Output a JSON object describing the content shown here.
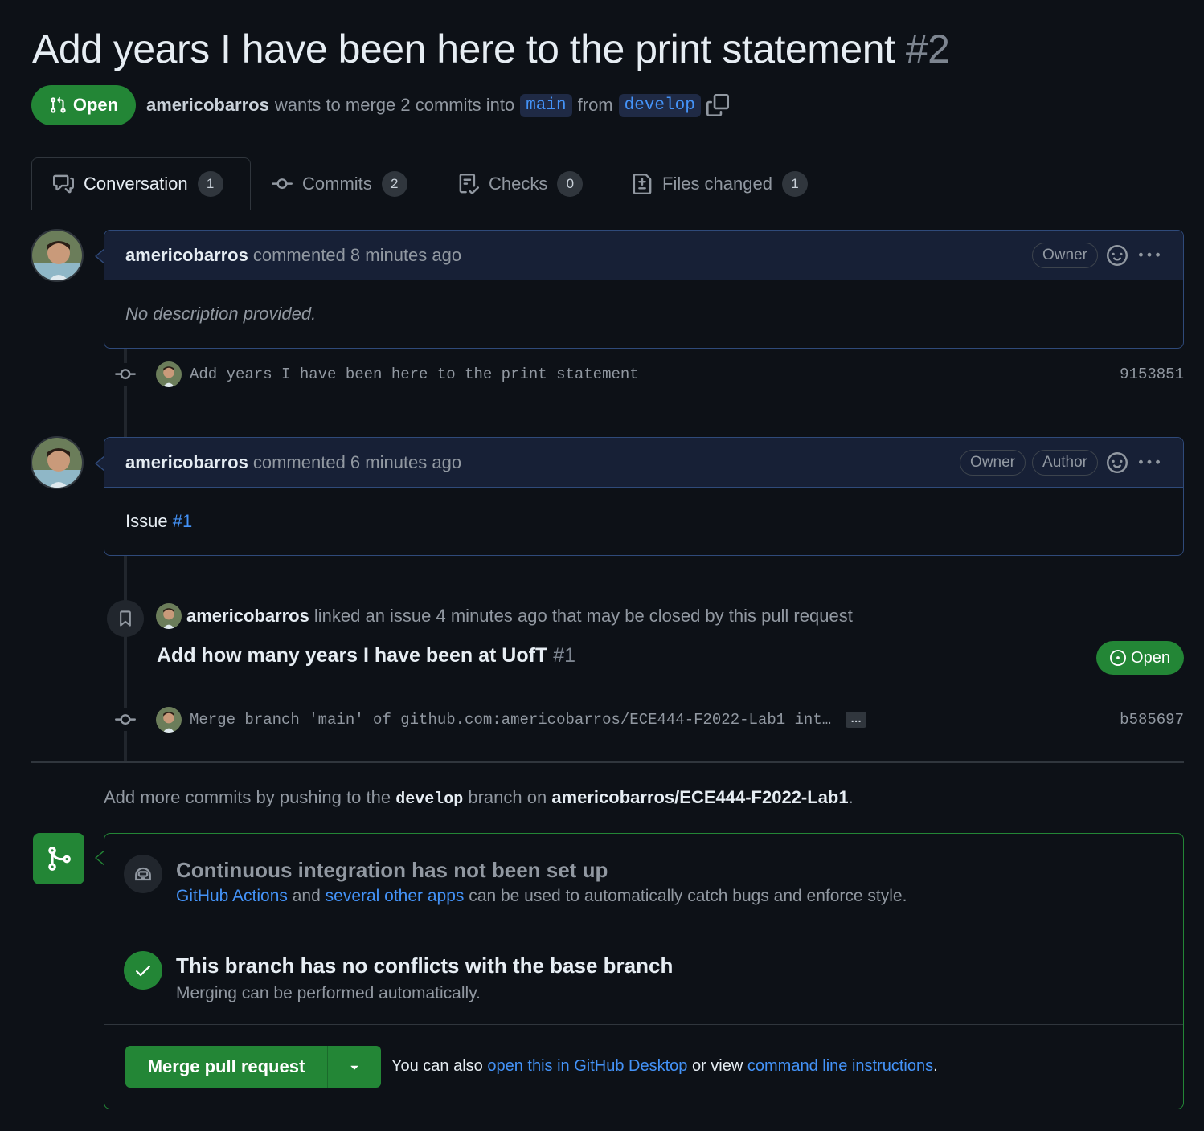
{
  "pr": {
    "title": "Add years I have been here to the print statement",
    "number": "#2",
    "state": "Open",
    "author": "americobarros",
    "meta_wants": "wants to merge 2 commits into",
    "base_branch": "main",
    "meta_from": "from",
    "head_branch": "develop"
  },
  "tabs": [
    {
      "label": "Conversation",
      "count": "1",
      "icon": "comment-discussion-icon"
    },
    {
      "label": "Commits",
      "count": "2",
      "icon": "commit-icon"
    },
    {
      "label": "Checks",
      "count": "0",
      "icon": "checklist-icon"
    },
    {
      "label": "Files changed",
      "count": "1",
      "icon": "file-diff-icon"
    }
  ],
  "comments": [
    {
      "author": "americobarros",
      "action": "commented 8 minutes ago",
      "roles": [
        "Owner"
      ],
      "body": "No description provided."
    },
    {
      "author": "americobarros",
      "action": "commented 6 minutes ago",
      "roles": [
        "Owner",
        "Author"
      ],
      "body_prefix": "Issue",
      "body_link": "#1"
    }
  ],
  "commits": [
    {
      "message": "Add years I have been here to the print statement",
      "sha": "9153851"
    },
    {
      "message": "Merge branch 'main' of github.com:americobarros/ECE444-F2022-Lab1 int…",
      "sha": "b585697",
      "more": "…"
    }
  ],
  "linked_event": {
    "author": "americobarros",
    "text_before": "linked an issue 4 minutes ago that may be",
    "text_closed": "closed",
    "text_after": "by this pull request",
    "issue_title": "Add how many years I have been at UofT",
    "issue_number": "#1",
    "issue_state": "Open"
  },
  "push_hint": {
    "prefix": "Add more commits by pushing to the",
    "branch": "develop",
    "middle": "branch on",
    "repo": "americobarros/ECE444-F2022-Lab1",
    "suffix": "."
  },
  "merge_box": {
    "ci_title": "Continuous integration has not been set up",
    "ci_link1": "GitHub Actions",
    "ci_and": "and",
    "ci_link2": "several other apps",
    "ci_rest": "can be used to automatically catch bugs and enforce style.",
    "conflict_title": "This branch has no conflicts with the base branch",
    "conflict_sub": "Merging can be performed automatically.",
    "merge_button": "Merge pull request",
    "alt_prefix": "You can also",
    "alt_link1": "open this in GitHub Desktop",
    "alt_middle": "or view",
    "alt_link2": "command line instructions",
    "alt_suffix": "."
  },
  "colors": {
    "accent_green": "#238636",
    "link_blue": "#4493f8",
    "background": "#0d1117"
  }
}
